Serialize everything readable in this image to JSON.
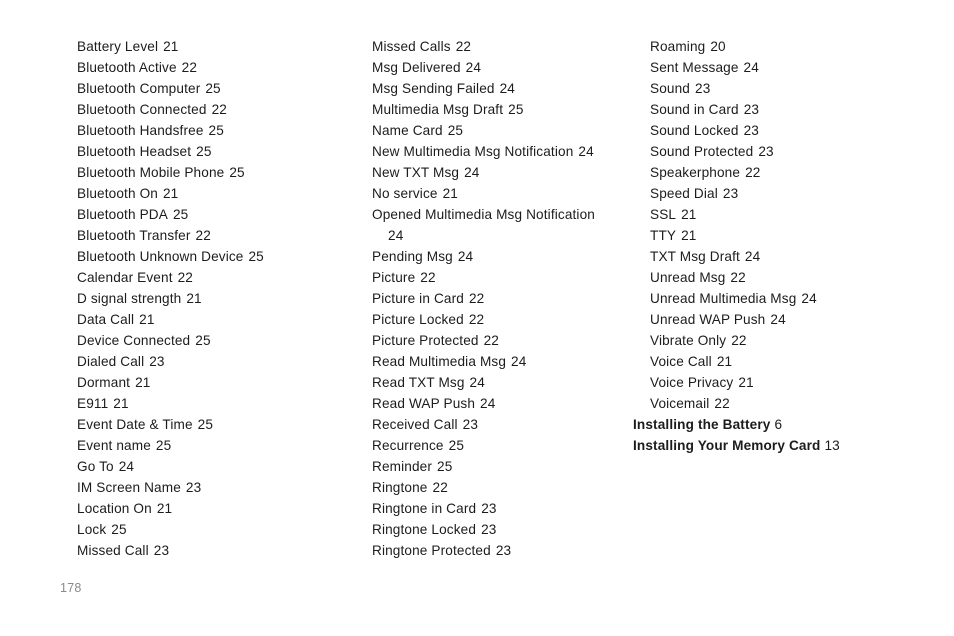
{
  "document": {
    "page_label": "178",
    "text_color": "#1c1c1c",
    "page_number_color": "#8a8a8a",
    "background_color": "#ffffff"
  },
  "columns": [
    {
      "id": "column-1",
      "entries": [
        {
          "label": "Battery Level",
          "page": "21",
          "bold": false
        },
        {
          "label": "Bluetooth Active",
          "page": "22",
          "bold": false
        },
        {
          "label": "Bluetooth Computer",
          "page": "25",
          "bold": false
        },
        {
          "label": "Bluetooth Connected",
          "page": "22",
          "bold": false
        },
        {
          "label": "Bluetooth Handsfree",
          "page": "25",
          "bold": false
        },
        {
          "label": "Bluetooth Headset",
          "page": "25",
          "bold": false
        },
        {
          "label": "Bluetooth Mobile Phone",
          "page": "25",
          "bold": false
        },
        {
          "label": "Bluetooth On",
          "page": "21",
          "bold": false
        },
        {
          "label": "Bluetooth PDA",
          "page": "25",
          "bold": false
        },
        {
          "label": "Bluetooth Transfer",
          "page": "22",
          "bold": false
        },
        {
          "label": "Bluetooth Unknown Device",
          "page": "25",
          "bold": false
        },
        {
          "label": "Calendar Event",
          "page": "22",
          "bold": false
        },
        {
          "label": "D signal strength",
          "page": "21",
          "bold": false
        },
        {
          "label": "Data Call",
          "page": "21",
          "bold": false
        },
        {
          "label": "Device Connected",
          "page": "25",
          "bold": false
        },
        {
          "label": "Dialed Call",
          "page": "23",
          "bold": false
        },
        {
          "label": "Dormant",
          "page": "21",
          "bold": false
        },
        {
          "label": "E911",
          "page": "21",
          "bold": false
        },
        {
          "label": "Event Date & Time",
          "page": "25",
          "bold": false
        },
        {
          "label": "Event name",
          "page": "25",
          "bold": false
        },
        {
          "label": "Go To",
          "page": "24",
          "bold": false
        },
        {
          "label": "IM Screen Name",
          "page": "23",
          "bold": false
        },
        {
          "label": "Location On",
          "page": "21",
          "bold": false
        },
        {
          "label": "Lock",
          "page": "25",
          "bold": false
        },
        {
          "label": "Missed Call",
          "page": "23",
          "bold": false
        }
      ]
    },
    {
      "id": "column-2",
      "entries": [
        {
          "label": "Missed Calls",
          "page": "22",
          "bold": false
        },
        {
          "label": "Msg Delivered",
          "page": "24",
          "bold": false
        },
        {
          "label": "Msg Sending Failed",
          "page": "24",
          "bold": false
        },
        {
          "label": "Multimedia Msg Draft",
          "page": "25",
          "bold": false
        },
        {
          "label": "Name Card",
          "page": "25",
          "bold": false
        },
        {
          "label": "New Multimedia Msg Notification",
          "page": "24",
          "bold": false
        },
        {
          "label": "New TXT Msg",
          "page": "24",
          "bold": false
        },
        {
          "label": "No service",
          "page": "21",
          "bold": false
        },
        {
          "label": "Opened Multimedia Msg Notification",
          "page": "24",
          "bold": false,
          "wrapped": true
        },
        {
          "label": "Pending Msg",
          "page": "24",
          "bold": false
        },
        {
          "label": "Picture",
          "page": "22",
          "bold": false
        },
        {
          "label": "Picture in Card",
          "page": "22",
          "bold": false
        },
        {
          "label": "Picture Locked",
          "page": "22",
          "bold": false
        },
        {
          "label": "Picture Protected",
          "page": "22",
          "bold": false
        },
        {
          "label": "Read Multimedia Msg",
          "page": "24",
          "bold": false
        },
        {
          "label": "Read TXT Msg",
          "page": "24",
          "bold": false
        },
        {
          "label": "Read WAP Push",
          "page": "24",
          "bold": false
        },
        {
          "label": "Received Call",
          "page": "23",
          "bold": false
        },
        {
          "label": "Recurrence",
          "page": "25",
          "bold": false
        },
        {
          "label": "Reminder",
          "page": "25",
          "bold": false
        },
        {
          "label": "Ringtone",
          "page": "22",
          "bold": false
        },
        {
          "label": "Ringtone in Card",
          "page": "23",
          "bold": false
        },
        {
          "label": "Ringtone Locked",
          "page": "23",
          "bold": false
        },
        {
          "label": "Ringtone Protected",
          "page": "23",
          "bold": false
        }
      ]
    },
    {
      "id": "column-3",
      "entries": [
        {
          "label": "Roaming",
          "page": "20",
          "bold": false
        },
        {
          "label": "Sent Message",
          "page": "24",
          "bold": false
        },
        {
          "label": "Sound",
          "page": "23",
          "bold": false
        },
        {
          "label": "Sound in Card",
          "page": "23",
          "bold": false
        },
        {
          "label": "Sound Locked",
          "page": "23",
          "bold": false
        },
        {
          "label": "Sound Protected",
          "page": "23",
          "bold": false
        },
        {
          "label": "Speakerphone",
          "page": "22",
          "bold": false
        },
        {
          "label": "Speed Dial",
          "page": "23",
          "bold": false
        },
        {
          "label": "SSL",
          "page": "21",
          "bold": false
        },
        {
          "label": "TTY",
          "page": "21",
          "bold": false
        },
        {
          "label": "TXT Msg Draft",
          "page": "24",
          "bold": false
        },
        {
          "label": "Unread Msg",
          "page": "22",
          "bold": false
        },
        {
          "label": "Unread Multimedia Msg",
          "page": "24",
          "bold": false
        },
        {
          "label": "Unread WAP Push",
          "page": "24",
          "bold": false
        },
        {
          "label": "Vibrate Only",
          "page": "22",
          "bold": false
        },
        {
          "label": "Voice Call",
          "page": "21",
          "bold": false
        },
        {
          "label": "Voice Privacy",
          "page": "21",
          "bold": false
        },
        {
          "label": "Voicemail",
          "page": "22",
          "bold": false
        },
        {
          "label": "Installing the Battery",
          "page": "6",
          "bold": true
        },
        {
          "label": "Installing Your Memory Card",
          "page": "13",
          "bold": true
        }
      ]
    }
  ]
}
